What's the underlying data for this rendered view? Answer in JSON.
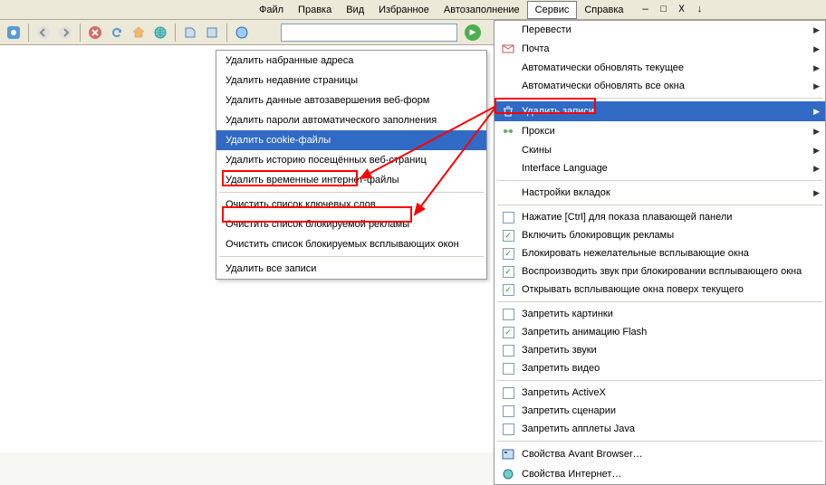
{
  "menubar": {
    "items": [
      "Файл",
      "Правка",
      "Вид",
      "Избранное",
      "Автозаполнение",
      "Сервис",
      "Справка"
    ],
    "highlighted_index": 5
  },
  "toolbar": {
    "url_value": ""
  },
  "dropdown": {
    "items": [
      {
        "label": "Перевести",
        "icon": "",
        "arrow": true
      },
      {
        "label": "Почта",
        "icon": "mail",
        "arrow": true
      },
      {
        "label": "Автоматически обновлять текущее",
        "icon": "",
        "arrow": true
      },
      {
        "label": "Автоматически обновлять все окна",
        "icon": "",
        "arrow": true
      },
      {
        "sep": true
      },
      {
        "label": "Удалить записи",
        "icon": "trash",
        "arrow": true,
        "selected": true
      },
      {
        "label": "Прокси",
        "icon": "proxy",
        "arrow": true
      },
      {
        "label": "Скины",
        "icon": "",
        "arrow": true
      },
      {
        "label": "Interface Language",
        "icon": "",
        "arrow": true
      },
      {
        "sep": true
      },
      {
        "label": "Настройки вкладок",
        "icon": "",
        "arrow": true
      },
      {
        "sep": true
      },
      {
        "label": "Нажатие [Ctrl] для показа плавающей панели",
        "check": false
      },
      {
        "label": "Включить блокировщик рекламы",
        "check": true
      },
      {
        "label": "Блокировать нежелательные всплывающие окна",
        "check": true
      },
      {
        "label": "Воспроизводить звук при блокировании всплывающего окна",
        "check": true
      },
      {
        "label": "Открывать всплывающие окна поверх текущего",
        "check": true
      },
      {
        "sep": true
      },
      {
        "label": "Запретить картинки",
        "check": false
      },
      {
        "label": "Запретить анимацию Flash",
        "check": true
      },
      {
        "label": "Запретить звуки",
        "check": false
      },
      {
        "label": "Запретить видео",
        "check": false
      },
      {
        "sep": true
      },
      {
        "label": "Запретить ActiveX",
        "check": false
      },
      {
        "label": "Запретить сценарии",
        "check": false
      },
      {
        "label": "Запретить апплеты Java",
        "check": false
      },
      {
        "sep": true
      },
      {
        "label": "Свойства Avant Browser…",
        "icon": "settings"
      },
      {
        "label": "Свойства Интернет…",
        "icon": "inet"
      }
    ]
  },
  "submenu": {
    "items": [
      {
        "label": "Удалить набранные адреса"
      },
      {
        "label": "Удалить недавние страницы"
      },
      {
        "label": "Удалить данные автозавершения веб-форм"
      },
      {
        "label": "Удалить пароли автоматического заполнения"
      },
      {
        "label": "Удалить cookie-файлы",
        "selected": true
      },
      {
        "label": "Удалить историю посещённых веб-страниц"
      },
      {
        "label": "Удалить временные интернет-файлы"
      },
      {
        "sep": true
      },
      {
        "label": "Очистить список ключевых слов"
      },
      {
        "label": "Очистить список блокируемой рекламы"
      },
      {
        "label": "Очистить список блокируемых всплывающих окон"
      },
      {
        "sep": true
      },
      {
        "label": "Удалить все записи"
      }
    ]
  }
}
